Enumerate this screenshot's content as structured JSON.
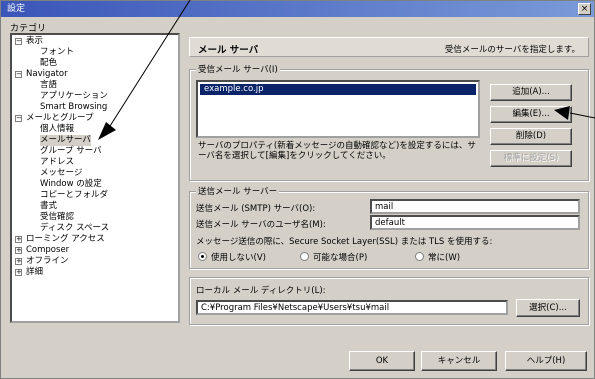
{
  "window": {
    "title": "設定",
    "close_label": "×"
  },
  "category": {
    "label": "カテゴリ",
    "items": [
      {
        "label": "表示",
        "expander": "−"
      },
      {
        "label": "フォント"
      },
      {
        "label": "配色"
      },
      {
        "label": "Navigator",
        "expander": "−"
      },
      {
        "label": "言語"
      },
      {
        "label": "アプリケーション"
      },
      {
        "label": "Smart Browsing"
      },
      {
        "label": "メールとグループ",
        "expander": "−"
      },
      {
        "label": "個人情報"
      },
      {
        "label": "メールサーバ"
      },
      {
        "label": "グループ サーバ"
      },
      {
        "label": "アドレス"
      },
      {
        "label": "メッセージ"
      },
      {
        "label": "Window の設定"
      },
      {
        "label": "コピーとフォルダ"
      },
      {
        "label": "書式"
      },
      {
        "label": "受信確認"
      },
      {
        "label": "ディスク スペース"
      },
      {
        "label": "ローミング アクセス",
        "expander": "+"
      },
      {
        "label": "Composer",
        "expander": "+"
      },
      {
        "label": "オフライン",
        "expander": "+"
      },
      {
        "label": "詳細",
        "expander": "+"
      }
    ]
  },
  "panel": {
    "title": "メール サーバ",
    "description": "受信メールのサーバを指定します。"
  },
  "incoming": {
    "label": "受信メール サーバ(I)",
    "servers": [
      "example.co.jp"
    ],
    "note": "サーバのプロパティ(新着メッセージの自動確認など)を設定するには、サーバ名を選択して[編集]をクリックしてください。",
    "add_label": "追加(A)...",
    "edit_label": "編集(E)...",
    "delete_label": "削除(D)",
    "default_label": "標準に設定(S)"
  },
  "outgoing": {
    "label": "送信メール サーバー",
    "smtp_label": "送信メール (SMTP) サーバ(O):",
    "smtp_value": "mail",
    "user_label": "送信メール サーバのユーザ名(M):",
    "user_value": "default",
    "ssl_label": "メッセージ送信の際に、Secure Socket Layer(SSL) または TLS を使用する:",
    "opt_never": "使用しない(V)",
    "opt_possible": "可能な場合(P)",
    "opt_always": "常に(W)"
  },
  "local": {
    "label": "ローカル メール ディレクトリ(L):",
    "path": "C:¥Program Files¥Netscape¥Users¥tsu¥mail",
    "choose_label": "選択(C)..."
  },
  "footer": {
    "ok_label": "OK",
    "cancel_label": "キャンセル",
    "help_label": "ヘルプ(H)"
  }
}
